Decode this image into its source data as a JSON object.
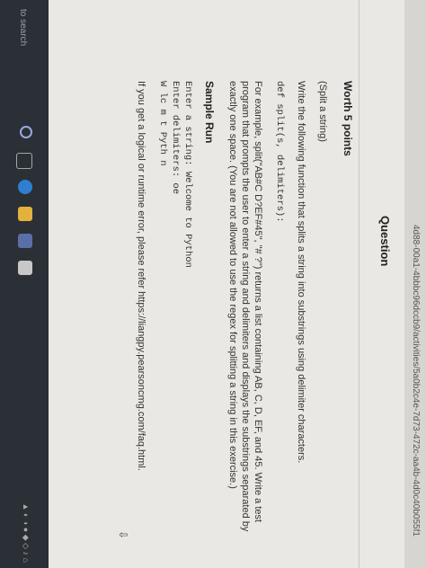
{
  "browser": {
    "url_fragment": "4d88-00a1-4bbbc96dccb9/activities/5a0b2c4e-7d73-472c-aa4b-4d0c40b055f1"
  },
  "page": {
    "question_title": "Question",
    "worth": "Worth 5 points",
    "problem_name": "(Split a string)",
    "instruction": "Write the following function that splits a string into substrings using delimiter characters.",
    "signature": "def split(s, delimiters):",
    "example_text": "For example, split(\"AB#C D?EF#45\", \"# ?\") returns a list containing AB, C, D, EF, and 45. Write a test program that prompts the user to enter a string and delimiters and displays the substrings separated by exactly one space. (You are not allowed to use the regex for splitting a string in this exercise.)",
    "sample_run_heading": "Sample Run",
    "sample_run_lines": [
      "Enter a string: Welcome to Python",
      "Enter delimiters: oe",
      "W lc m t Pyth n"
    ],
    "error_note": "If you get a logical or runtime error, please refer https://liangpy.pearsoncmg.com/faq.html."
  },
  "taskbar": {
    "search_placeholder": "to search"
  },
  "colors": {
    "page_bg": "#e9e8e4",
    "taskbar_bg": "#2b3036",
    "text": "#333333"
  }
}
